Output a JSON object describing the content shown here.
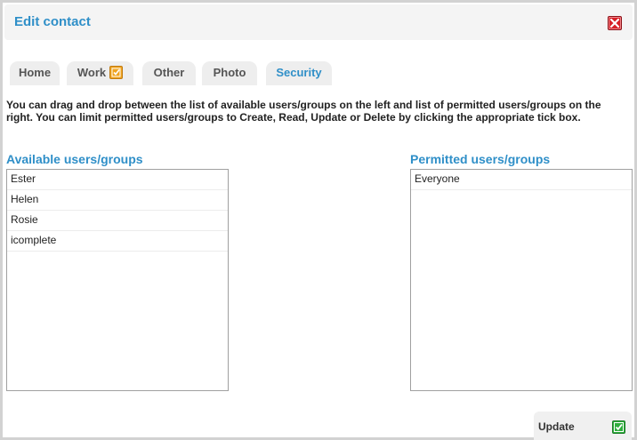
{
  "dialog": {
    "title": "Edit contact",
    "close_icon": "close-icon"
  },
  "tabs": [
    {
      "label": "Home",
      "active": false
    },
    {
      "label": "Work",
      "active": false,
      "icon": "checkbox-checked-icon"
    },
    {
      "label": "Other",
      "active": false
    },
    {
      "label": "Photo",
      "active": false
    },
    {
      "label": "Security",
      "active": true
    }
  ],
  "instructions": "You can drag and drop between the list of available users/groups on the left and list of permitted users/groups on the right. You can limit permitted users/groups to Create, Read, Update or Delete by clicking the appropriate tick box.",
  "available": {
    "label": "Available users/groups",
    "items": [
      "Ester",
      "Helen",
      "Rosie",
      "icomplete"
    ]
  },
  "permitted": {
    "label": "Permitted users/groups",
    "items": [
      "Everyone"
    ]
  },
  "footer": {
    "update_label": "Update",
    "update_icon": "checkmark-icon"
  },
  "colors": {
    "accent": "#2f8fc8",
    "close": "#d71f26",
    "work_tick": "#f0a420",
    "update_tick": "#2fae3d"
  }
}
